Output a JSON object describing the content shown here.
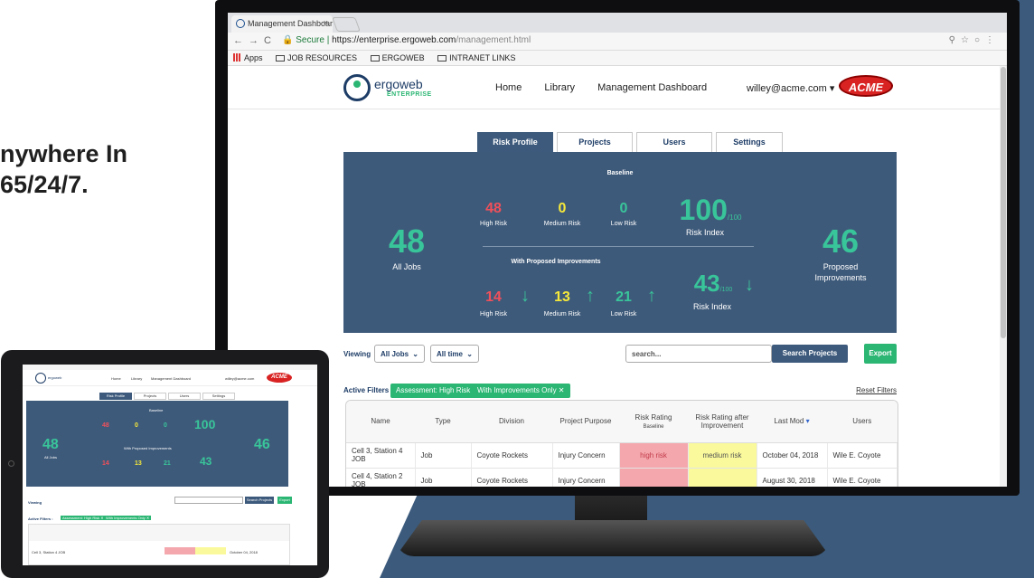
{
  "left_headline": [
    "nywhere In",
    "65/24/7."
  ],
  "browser": {
    "tab_title": "Management Dashboard | Erg",
    "url_secure": "Secure",
    "url_host": "https://enterprise.ergoweb.com",
    "url_path": "/management.html",
    "bookmarks": [
      "Apps",
      "JOB RESOURCES",
      "ERGOWEB",
      "INTRANET LINKS"
    ]
  },
  "header": {
    "logo_text": "ergoweb",
    "logo_sub": "ENTERPRISE",
    "nav": [
      "Home",
      "Library",
      "Management Dashboard"
    ],
    "user": "willey@acme.com",
    "brand": "ACME"
  },
  "tabs": [
    "Risk Profile",
    "Projects",
    "Users",
    "Settings"
  ],
  "stats": {
    "baseline_label": "Baseline",
    "all_jobs": {
      "value": "48",
      "label": "All Jobs"
    },
    "baseline": {
      "high": {
        "value": "48",
        "label": "High Risk"
      },
      "medium": {
        "value": "0",
        "label": "Medium Risk"
      },
      "low": {
        "value": "0",
        "label": "Low Risk"
      },
      "index": {
        "value": "100",
        "suffix": "/100",
        "label": "Risk Index"
      }
    },
    "improvements_label": "With Proposed Improvements",
    "improved": {
      "high": {
        "value": "14",
        "label": "High Risk"
      },
      "medium": {
        "value": "13",
        "label": "Medium Risk"
      },
      "low": {
        "value": "21",
        "label": "Low Risk"
      },
      "index": {
        "value": "43",
        "suffix": "/100",
        "label": "Risk Index"
      }
    },
    "proposed": {
      "value": "46",
      "label1": "Proposed",
      "label2": "Improvements"
    }
  },
  "controls": {
    "viewing_label": "Viewing",
    "jobs_select": "All Jobs",
    "time_select": "All time",
    "search_placeholder": "search...",
    "search_button": "Search Projects",
    "export_button": "Export"
  },
  "filters": {
    "label": "Active Filters :",
    "chips": [
      "Assessment: High Risk ✕",
      "With Improvements Only ✕"
    ],
    "reset": "Reset Filters"
  },
  "table": {
    "headers": [
      "Name",
      "Type",
      "Division",
      "Project Purpose",
      "Risk Rating",
      "Baseline",
      "Risk Rating after Improvement",
      "Last Mod",
      "Users"
    ],
    "rows": [
      [
        "Cell 3, Station 4 JOB",
        "Job",
        "Coyote Rockets",
        "Injury Concern",
        "high risk",
        "medium risk",
        "October 04, 2018",
        "Wile E. Coyote"
      ],
      [
        "Cell 4, Station 2 JOB",
        "Job",
        "Coyote Rockets",
        "Injury Concern",
        "",
        "",
        "August 30, 2018",
        "Wile E. Coyote"
      ]
    ]
  },
  "colors": {
    "panel": "#3e5a7a",
    "accent_green": "#2bb673",
    "high": "#f0505a",
    "medium": "#f6e93a",
    "low": "#39c59a",
    "brand_red": "#d92323"
  }
}
